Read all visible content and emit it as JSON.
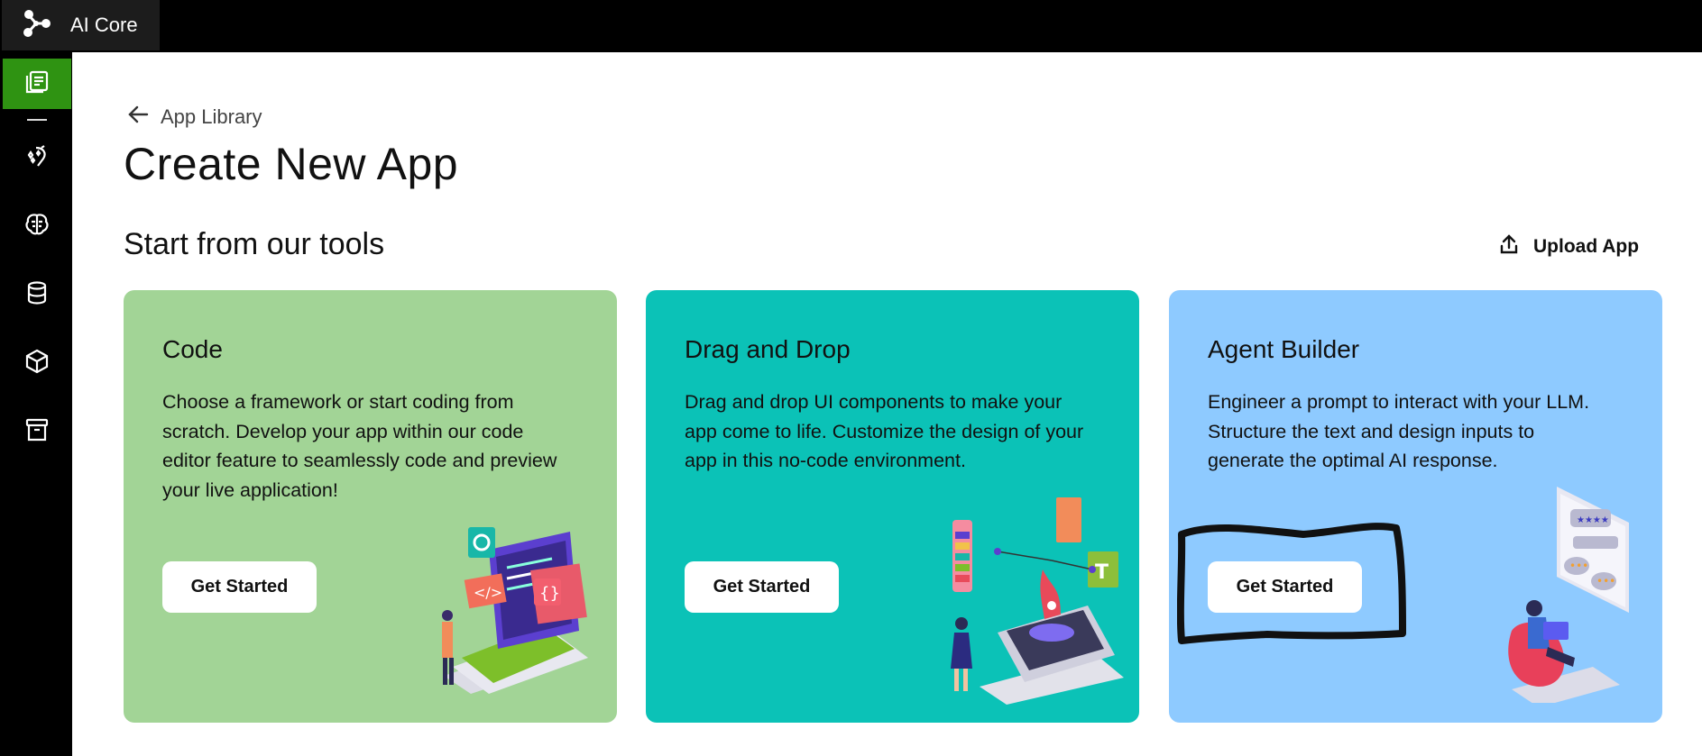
{
  "app": {
    "title": "AI Core"
  },
  "sidebar": {
    "items": [
      {
        "icon": "app-library-icon",
        "active": true
      },
      {
        "icon": "sparkle-magic-icon"
      },
      {
        "icon": "brain-icon"
      },
      {
        "icon": "database-icon"
      },
      {
        "icon": "cube-icon"
      },
      {
        "icon": "archive-icon"
      }
    ],
    "active_color": "#2f9312"
  },
  "breadcrumb": {
    "back_label": "App Library"
  },
  "page": {
    "title": "Create New App",
    "section_title": "Start from our tools",
    "upload_label": "Upload App"
  },
  "cards": [
    {
      "title": "Code",
      "description": "Choose a framework or start coding from scratch. Develop your app within our code editor feature to seamlessly code and preview your live application!",
      "button": "Get Started",
      "color": "#a2d496"
    },
    {
      "title": "Drag and Drop",
      "description": "Drag and drop UI components to make your app come to life. Customize the design of your app in this no-code environment.",
      "button": "Get Started",
      "color": "#0bc2b7"
    },
    {
      "title": "Agent Builder",
      "description": "Engineer a prompt to interact with your LLM. Structure the text and design inputs to generate the optimal AI response.",
      "button": "Get Started",
      "color": "#8ecaff"
    }
  ]
}
